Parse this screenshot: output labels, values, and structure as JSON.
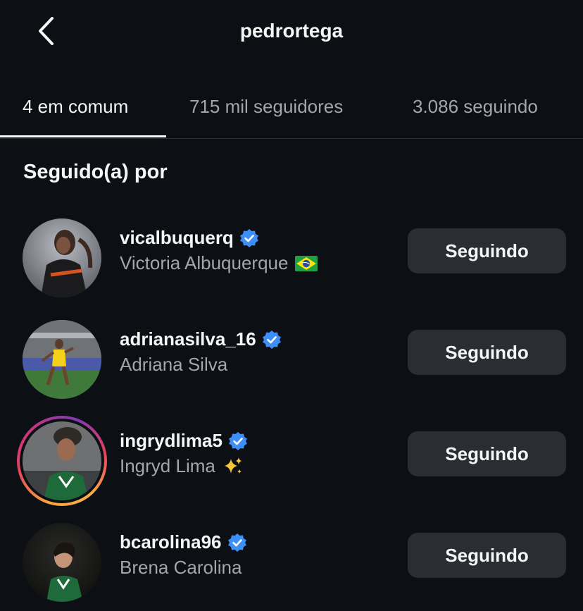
{
  "header": {
    "title": "pedrortega",
    "back_icon": "chevron-left-icon"
  },
  "tabs": [
    {
      "label": "4 em comum",
      "active": true
    },
    {
      "label": "715 mil seguidores",
      "active": false
    },
    {
      "label": "3.086 seguindo",
      "active": false
    }
  ],
  "section_title": "Seguido(a) por",
  "users": [
    {
      "username": "vicalbuquerq",
      "full_name": "Victoria Albuquerque",
      "emoji": "brazil-flag",
      "verified": true,
      "button": "Seguindo",
      "story_ring": false
    },
    {
      "username": "adrianasilva_16",
      "full_name": "Adriana Silva",
      "verified": true,
      "button": "Seguindo",
      "story_ring": false
    },
    {
      "username": "ingrydlima5",
      "full_name": "Ingryd Lima",
      "emoji": "sparkles",
      "verified": true,
      "button": "Seguindo",
      "story_ring": true
    },
    {
      "username": "bcarolina96",
      "full_name": "Brena Carolina",
      "verified": true,
      "button": "Seguindo",
      "story_ring": false
    }
  ],
  "colors": {
    "background": "#0c0f14",
    "verified_blue": "#3d8ff7",
    "button_bg": "#2a2d34",
    "secondary_text": "#a2a6ae"
  }
}
